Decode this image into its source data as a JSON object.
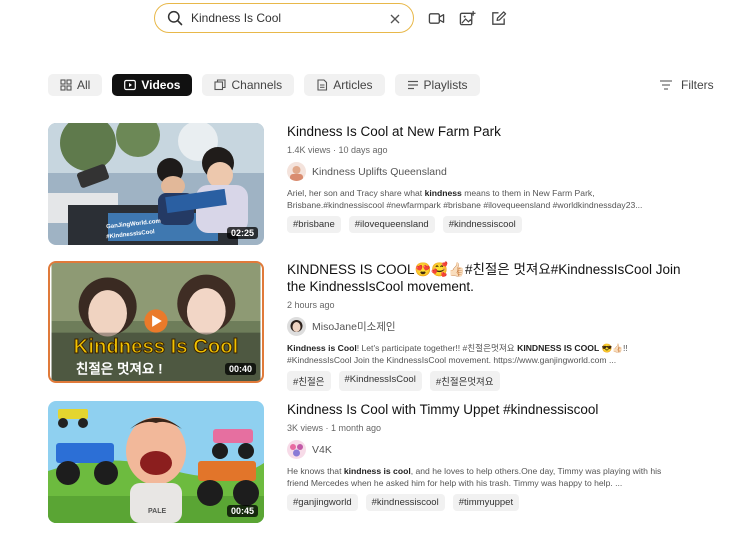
{
  "search": {
    "query": "Kindness Is Cool",
    "icons": [
      "search-icon",
      "clear-icon",
      "video-upload-icon",
      "image-upload-icon",
      "edit-icon"
    ]
  },
  "tabs": [
    {
      "label": "All",
      "icon": "grid-icon",
      "active": false
    },
    {
      "label": "Videos",
      "icon": "play-icon",
      "active": true
    },
    {
      "label": "Channels",
      "icon": "channels-icon",
      "active": false
    },
    {
      "label": "Articles",
      "icon": "article-icon",
      "active": false
    },
    {
      "label": "Playlists",
      "icon": "playlist-icon",
      "active": false
    }
  ],
  "filters_label": "Filters",
  "results": [
    {
      "title": "Kindness Is Cool at New Farm Park",
      "meta": "1.4K views · 10 days ago",
      "channel": "Kindness Uplifts Queensland",
      "desc_1a": "Ariel, her son and Tracy share what ",
      "desc_1b": "kindness",
      "desc_1c": " means to them in New Farm Park,",
      "desc_2": "Brisbane.#kindnessiscool #newfarmpark #brisbane #ilovequeensland #worldkindnessday23...",
      "duration": "02:25",
      "thumb_texts": [
        "GanJingWorld.com",
        "#KindnessIsCool"
      ],
      "tags": [
        "#brisbane",
        "#ilovequeensland",
        "#kindnessiscool"
      ]
    },
    {
      "title_1": "KINDNESS IS COOL😍🥰👍🏻#친절은 멋져요#KindnessIsCool Join",
      "title_2": "the KindnessIsCool movement.",
      "meta": "2 hours ago",
      "channel": "MisoJane미소제인",
      "desc_1a": "Kindness is Cool",
      "desc_1b": "! Let's participate together!! #친절은멋져요 ",
      "desc_1c": "KINDNESS IS COOL",
      "desc_1d": " 😎👍🏻!!",
      "desc_2": "#KindnessIsCool Join the KindnessIsCool movement. https://www.ganjingworld.com ...",
      "duration": "00:40",
      "thumb_texts": [
        "Kindness Is Cool",
        "친절은 멋져요 !"
      ],
      "tags": [
        "#친절은",
        "#KindnessIsCool",
        "#친절은멋져요"
      ]
    },
    {
      "title": "Kindness Is Cool with Timmy Uppet #kindnessiscool",
      "meta": "3K views · 1 month ago",
      "channel": "V4K",
      "desc_1a": "He knows that ",
      "desc_1b": "kindness is cool",
      "desc_1c": ", and he loves to help others.One day, Timmy was playing with his",
      "desc_2": "friend Mercedes when he asked him for help with his trash. Timmy was happy to help. ...",
      "duration": "00:45",
      "thumb_texts": [
        "PALE"
      ],
      "tags": [
        "#ganjingworld",
        "#kindnessiscool",
        "#timmyuppet"
      ]
    }
  ],
  "colors": {
    "search_border": "#e8b84a",
    "active_tab": "#111111",
    "chip_bg": "#f1f1f1",
    "thumb2_border": "#e07a3a",
    "thumb2_text": "#f2c300"
  }
}
